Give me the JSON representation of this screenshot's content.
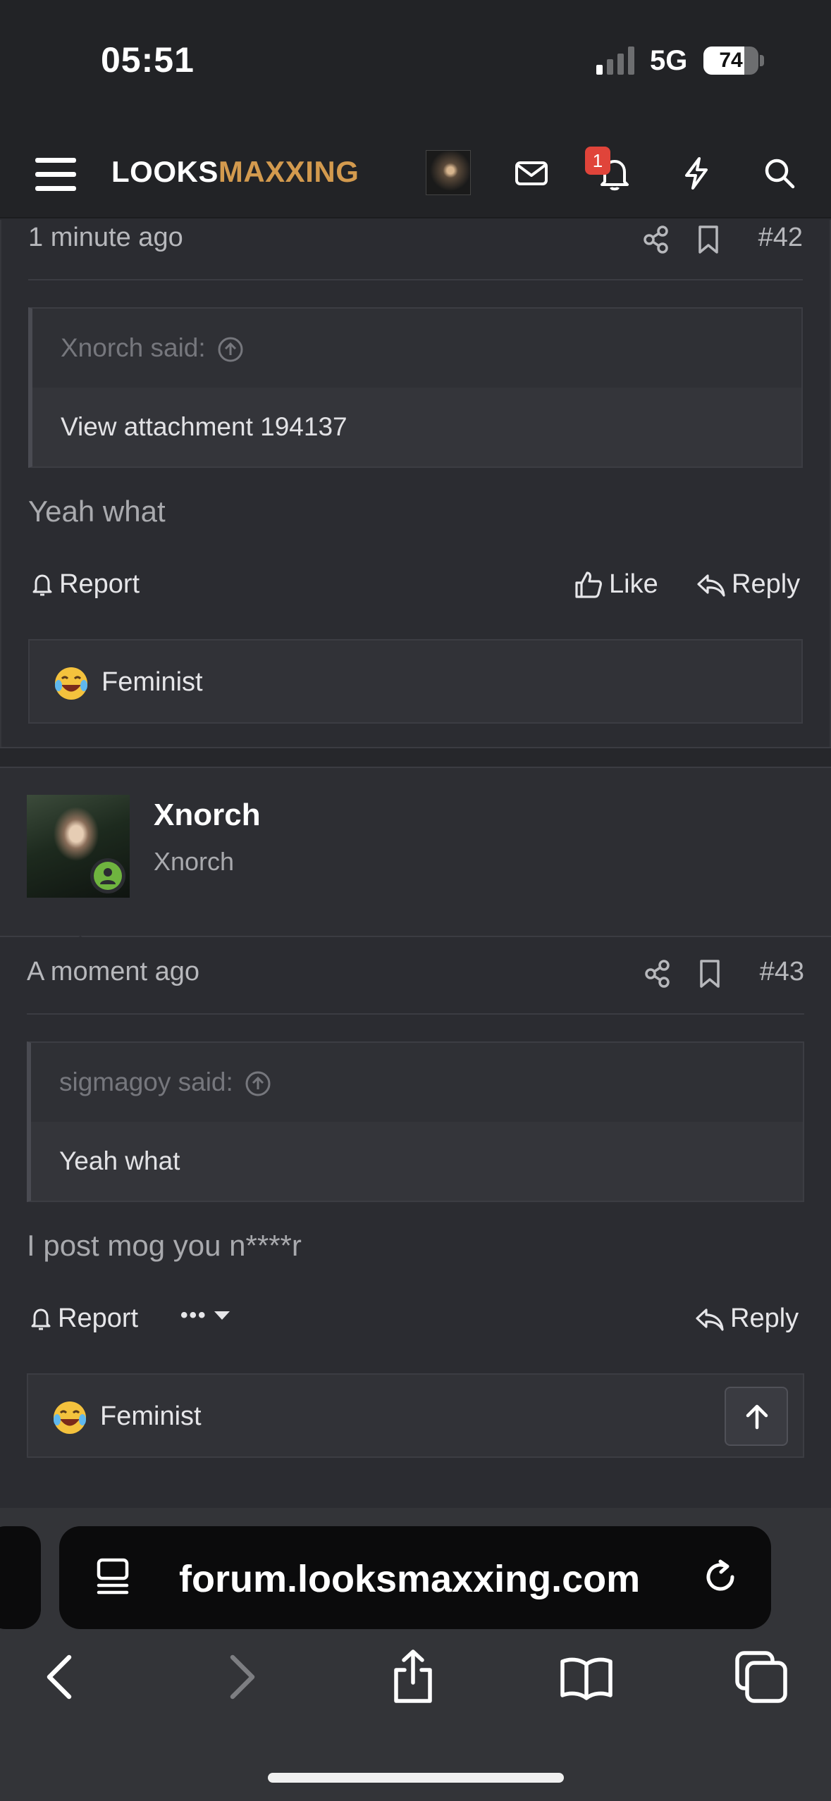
{
  "status_bar": {
    "time": "05:51",
    "network": "5G",
    "battery": "74",
    "battery_level": 0.74
  },
  "header": {
    "logo_part1": "LOOKS",
    "logo_part2": "MAXXING",
    "notification_count": "1",
    "icons": [
      "menu-icon",
      "avatar",
      "mail-icon",
      "bell-icon",
      "lightning-icon",
      "search-icon"
    ],
    "brand_color": "#d39a4e"
  },
  "posts": [
    {
      "time": "1 minute ago",
      "number": "#42",
      "quote_author": "Xnorch said:",
      "quote_text": "View attachment 194137",
      "message": "Yeah what",
      "actions": {
        "report": "Report",
        "like": "Like",
        "reply": "Reply"
      },
      "reaction": "Feminist"
    },
    {
      "author": "Xnorch",
      "author_title": "Xnorch",
      "time": "A moment ago",
      "number": "#43",
      "quote_author": "sigmagoy said:",
      "quote_text": "Yeah what",
      "message": "I post mog you n****r",
      "actions": {
        "report": "Report",
        "reply": "Reply",
        "more": "•••"
      },
      "reaction": "Feminist"
    }
  ],
  "browser": {
    "url": "forum.looksmaxxing.com"
  },
  "colors": {
    "online": "#6fb43f",
    "badge": "#e0443a",
    "background": "#2b2c31"
  }
}
